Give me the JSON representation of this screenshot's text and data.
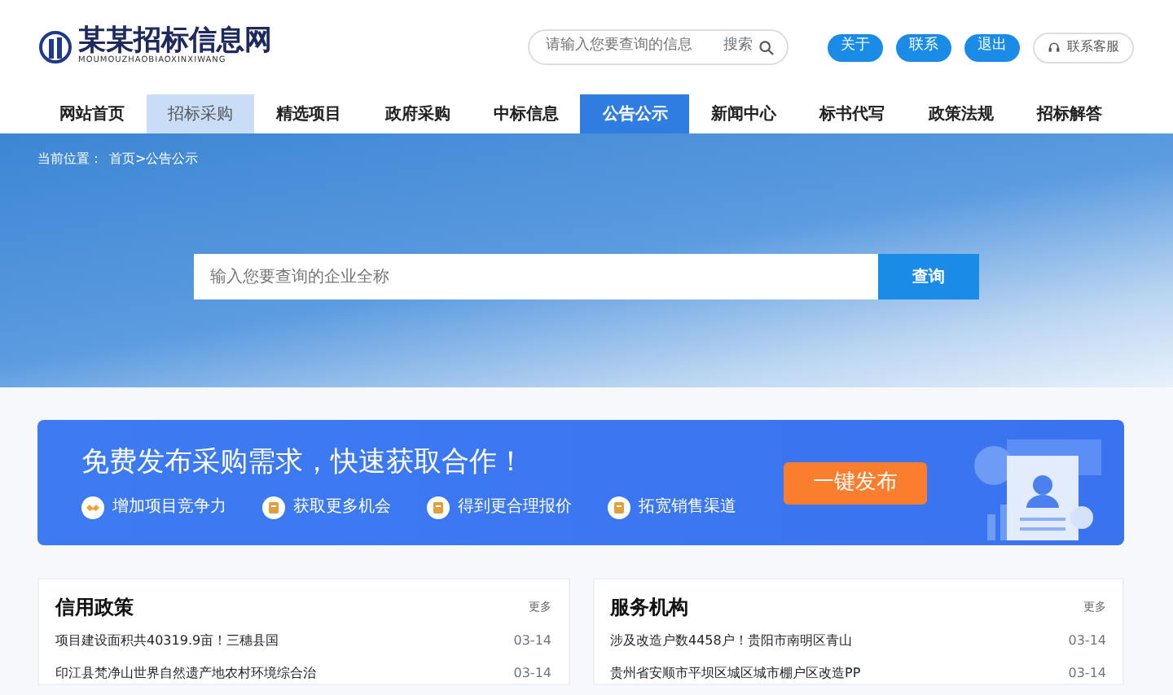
{
  "logo": {
    "title": "某某招标信息网",
    "subtitle": "MOUMOUZHAOBIAOXINXIWANG"
  },
  "top_search": {
    "placeholder": "请输入您要查询的信息",
    "button": "搜索"
  },
  "top_buttons": [
    {
      "label": "关于",
      "kind": "pill"
    },
    {
      "label": "联系",
      "kind": "pill"
    },
    {
      "label": "退出",
      "kind": "pill"
    },
    {
      "label": "联系客服",
      "kind": "service"
    }
  ],
  "nav": [
    {
      "label": "网站首页",
      "selected": false,
      "highlighted": false
    },
    {
      "label": "招标采购",
      "selected": false,
      "highlighted": true
    },
    {
      "label": "精选项目",
      "selected": false,
      "highlighted": false
    },
    {
      "label": "政府采购",
      "selected": false,
      "highlighted": false
    },
    {
      "label": "中标信息",
      "selected": false,
      "highlighted": false
    },
    {
      "label": "公告公示",
      "selected": true,
      "highlighted": false
    },
    {
      "label": "新闻中心",
      "selected": false,
      "highlighted": false
    },
    {
      "label": "标书代写",
      "selected": false,
      "highlighted": false
    },
    {
      "label": "政策法规",
      "selected": false,
      "highlighted": false
    },
    {
      "label": "招标解答",
      "selected": false,
      "highlighted": false
    }
  ],
  "breadcrumb": {
    "label": "当前位置：",
    "path": "首页>公告公示"
  },
  "hero_search": {
    "placeholder": "输入您要查询的企业全称",
    "button": "查询"
  },
  "promo": {
    "title": "免费发布采购需求，快速获取合作！",
    "button": "一键发布",
    "features": [
      {
        "label": "增加项目竞争力",
        "kind": "handshake"
      },
      {
        "label": "获取更多机会",
        "kind": "doc"
      },
      {
        "label": "得到更合理报价",
        "kind": "doc"
      },
      {
        "label": "拓宽销售渠道",
        "kind": "doc"
      }
    ]
  },
  "panels": [
    {
      "title": "信用政策",
      "more": "更多",
      "items": [
        {
          "text": "项目建设面积共40319.9亩！三穗县国",
          "date": "03-14"
        },
        {
          "text": "印江县梵净山世界自然遗产地农村环境综合治",
          "date": "03-14"
        }
      ]
    },
    {
      "title": "服务机构",
      "more": "更多",
      "items": [
        {
          "text": "涉及改造户数4458户！贵阳市南明区青山",
          "date": "03-14"
        },
        {
          "text": "贵州省安顺市平坝区城区城市棚户区改造PP",
          "date": "03-14"
        }
      ]
    }
  ]
}
